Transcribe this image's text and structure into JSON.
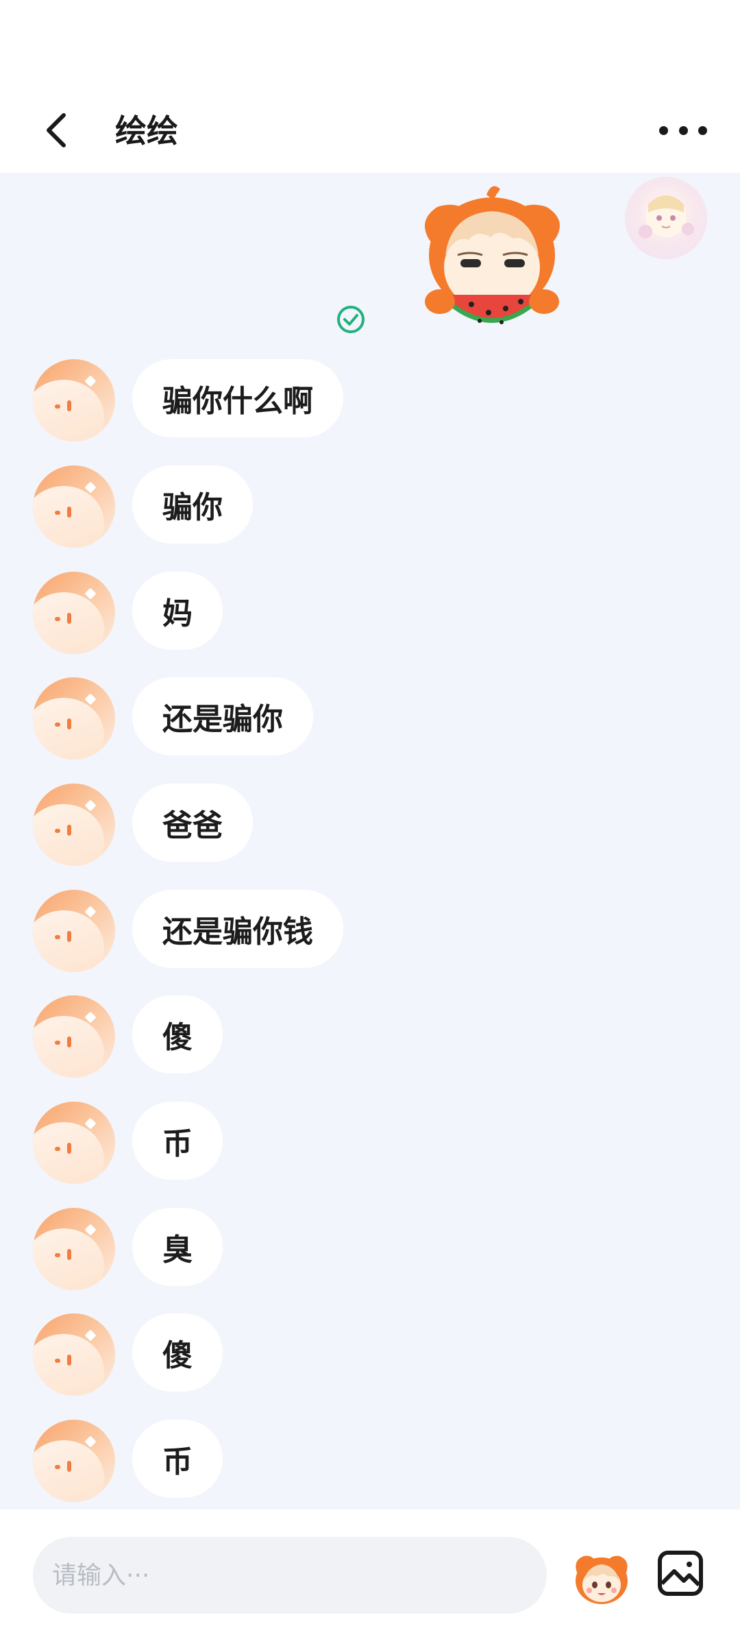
{
  "header": {
    "title": "绘绘"
  },
  "messages": [
    {
      "text": "骗你什么啊"
    },
    {
      "text": "骗你"
    },
    {
      "text": "妈"
    },
    {
      "text": "还是骗你"
    },
    {
      "text": "爸爸"
    },
    {
      "text": "还是骗你钱"
    },
    {
      "text": "傻"
    },
    {
      "text": "币"
    },
    {
      "text": "臭"
    },
    {
      "text": "傻"
    },
    {
      "text": "币"
    }
  ],
  "input": {
    "placeholder": "请输入···"
  },
  "icons": {
    "back": "chevron-left-icon",
    "more": "more-dots-icon",
    "read_status": "check-circle-icon",
    "emoji": "mascot-emoji-icon",
    "image": "image-icon"
  },
  "colors": {
    "accent_orange": "#f47a2c",
    "check_green": "#22b07d",
    "chat_background": "#f2f5fb"
  }
}
